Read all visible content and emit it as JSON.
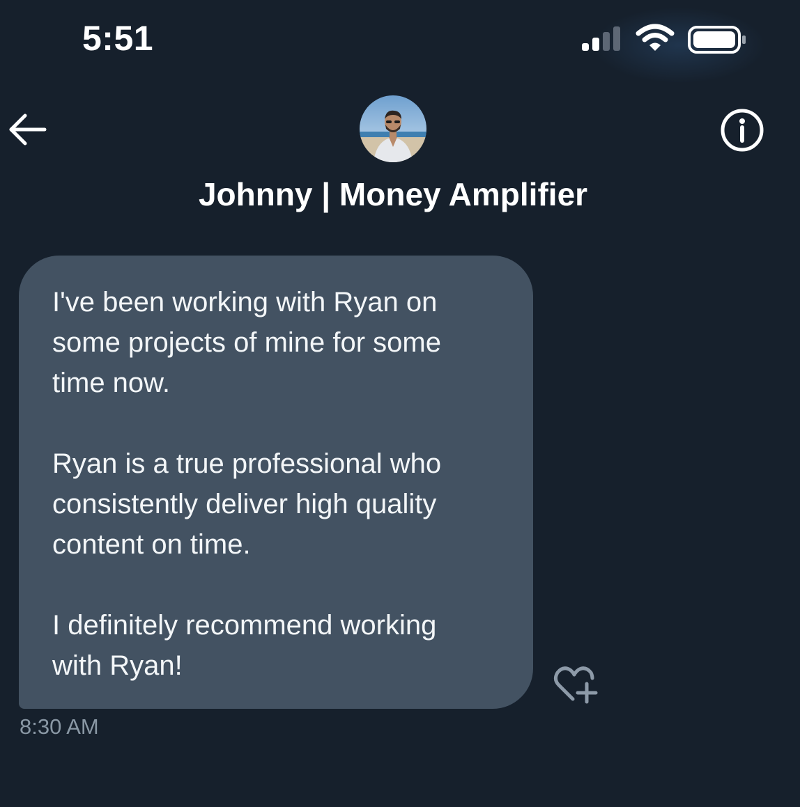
{
  "status_bar": {
    "time": "5:51",
    "icons": [
      "cellular-signal-icon",
      "wifi-icon",
      "battery-icon"
    ]
  },
  "header": {
    "back_icon": "back-arrow-icon",
    "info_icon": "info-icon",
    "contact_name": "Johnny | Money Amplifier"
  },
  "message": {
    "paragraphs": [
      "I've been working with Ryan on\nsome projects of mine for some\ntime now.",
      "Ryan is a true professional who\nconsistently deliver high quality\ncontent on time.",
      "I definitely recommend working\nwith Ryan!"
    ],
    "timestamp": "8:30 AM",
    "reaction_icon": "heart-add-icon"
  },
  "colors": {
    "background": "#16202c",
    "bubble": "#435262",
    "timestamp": "#8a98a5",
    "icon": "#ffffff",
    "reaction_icon": "#8d9aa8"
  }
}
